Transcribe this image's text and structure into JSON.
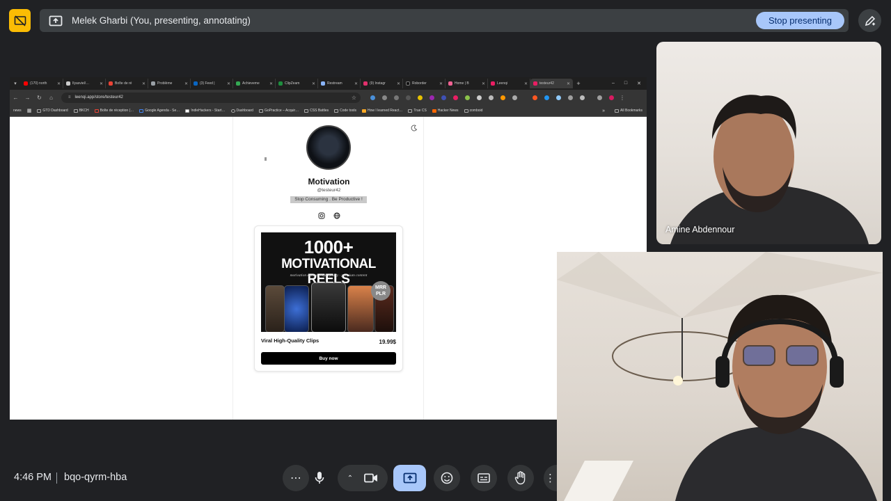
{
  "presenting_bar": {
    "presenter_label": "Melek Gharbi (You, presenting, annotating)",
    "stop_button": "Stop presenting"
  },
  "browser": {
    "tabs": [
      {
        "label": "(170) north",
        "color": "#ff0000"
      },
      {
        "label": "Ilyasviel/…",
        "color": "#cccccc"
      },
      {
        "label": "Boîte de ré",
        "color": "#ea4335"
      },
      {
        "label": "Problème",
        "color": "#9aa0a6"
      },
      {
        "label": "(3) Feed |",
        "color": "#0a66c2"
      },
      {
        "label": "Achieveme",
        "color": "#34a853"
      },
      {
        "label": "ClipZeam",
        "color": "#1e8e3e"
      },
      {
        "label": "Restream",
        "color": "#8ab4f8"
      },
      {
        "label": "(9) Instagr",
        "color": "#e1306c"
      },
      {
        "label": "Roborder",
        "color": "#111111"
      },
      {
        "label": "Home | B",
        "color": "#f06292"
      },
      {
        "label": "Leenqi",
        "color": "#e91e63"
      },
      {
        "label": "testeur42",
        "color": "#e91e63"
      }
    ],
    "url": "leenqi.app/store/testeur42",
    "bookmarks": [
      "GTD Dashboard",
      "BKCH",
      "Boîte de réception (…",
      "Google Agenda - Se…",
      "IndieHackers - Start…",
      "Dashboard",
      "GoPractice – Acquir…",
      "CSS Battles",
      "Code tools",
      "How I learned React…",
      "True CS",
      "Hacker News",
      "zomboid"
    ],
    "all_bookmarks": "All Bookmarks"
  },
  "store": {
    "title": "Motivation",
    "handle": "@testeur42",
    "bio": "Stop Consuming . Be Productive !",
    "product": {
      "image_line1": "1000+",
      "image_line2": "MOTIVATIONAL REELS",
      "image_line3": "motivation quotes · high quality · premium content",
      "badge": "MRR PLR",
      "name": "Viral High-Quality Clips",
      "price": "19.99$",
      "buy_label": "Buy now"
    }
  },
  "participants": {
    "remote_name": "Amine Abdennour"
  },
  "bottom_bar": {
    "time": "4:46 PM",
    "meeting_code": "bqo-qyrm-hba"
  },
  "colors": {
    "accent": "#a8c7fa",
    "present_icon_bg": "#fbbc04",
    "bar_bg": "#3c4043",
    "page_bg": "#202124"
  }
}
